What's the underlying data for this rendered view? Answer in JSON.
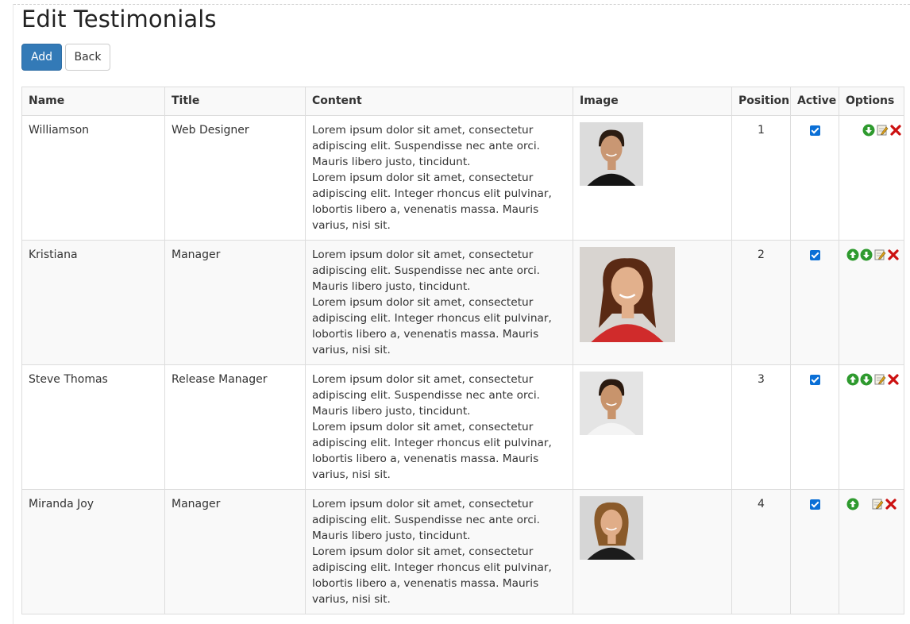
{
  "page": {
    "title": "Edit Testimonials"
  },
  "toolbar": {
    "add_label": "Add",
    "back_label": "Back"
  },
  "table": {
    "headers": {
      "name": "Name",
      "title": "Title",
      "content": "Content",
      "image": "Image",
      "position": "Position",
      "active": "Active",
      "options": "Options"
    },
    "rows": [
      {
        "name": "Williamson",
        "title": "Web Designer",
        "content_1": "Lorem ipsum dolor sit amet, consectetur adipiscing elit. Suspendisse nec ante orci. Mauris libero justo, tincidunt.",
        "content_2": "Lorem ipsum dolor sit amet, consectetur adipiscing elit. Integer rhoncus elit pulvinar, lobortis libero a, venenatis massa. Mauris varius, nisi sit.",
        "position": "1",
        "active": true,
        "options": [
          "move-down-icon",
          "edit-icon",
          "delete-icon"
        ]
      },
      {
        "name": "Kristiana",
        "title": "Manager",
        "content_1": "Lorem ipsum dolor sit amet, consectetur adipiscing elit. Suspendisse nec ante orci. Mauris libero justo, tincidunt.",
        "content_2": "Lorem ipsum dolor sit amet, consectetur adipiscing elit. Integer rhoncus elit pulvinar, lobortis libero a, venenatis massa. Mauris varius, nisi sit.",
        "position": "2",
        "active": true,
        "options": [
          "move-up-icon",
          "move-down-icon",
          "edit-icon",
          "delete-icon"
        ]
      },
      {
        "name": "Steve Thomas",
        "title": "Release Manager",
        "content_1": "Lorem ipsum dolor sit amet, consectetur adipiscing elit. Suspendisse nec ante orci. Mauris libero justo, tincidunt.",
        "content_2": "Lorem ipsum dolor sit amet, consectetur adipiscing elit. Integer rhoncus elit pulvinar, lobortis libero a, venenatis massa. Mauris varius, nisi sit.",
        "position": "3",
        "active": true,
        "options": [
          "move-up-icon",
          "move-down-icon",
          "edit-icon",
          "delete-icon"
        ]
      },
      {
        "name": "Miranda Joy",
        "title": "Manager",
        "content_1": "Lorem ipsum dolor sit amet, consectetur adipiscing elit. Suspendisse nec ante orci. Mauris libero justo, tincidunt.",
        "content_2": "Lorem ipsum dolor sit amet, consectetur adipiscing elit. Integer rhoncus elit pulvinar, lobortis libero a, venenatis massa. Mauris varius, nisi sit.",
        "position": "4",
        "active": true,
        "options": [
          "move-up-icon",
          "edit-icon",
          "delete-icon"
        ]
      }
    ]
  },
  "colors": {
    "primary_button": "#337ab7",
    "checkbox": "#0a6fd6",
    "arrow_icon": "#2e9a2e",
    "delete_icon": "#cc1111",
    "table_border": "#dddddd",
    "stripe": "#f9f9f9"
  }
}
